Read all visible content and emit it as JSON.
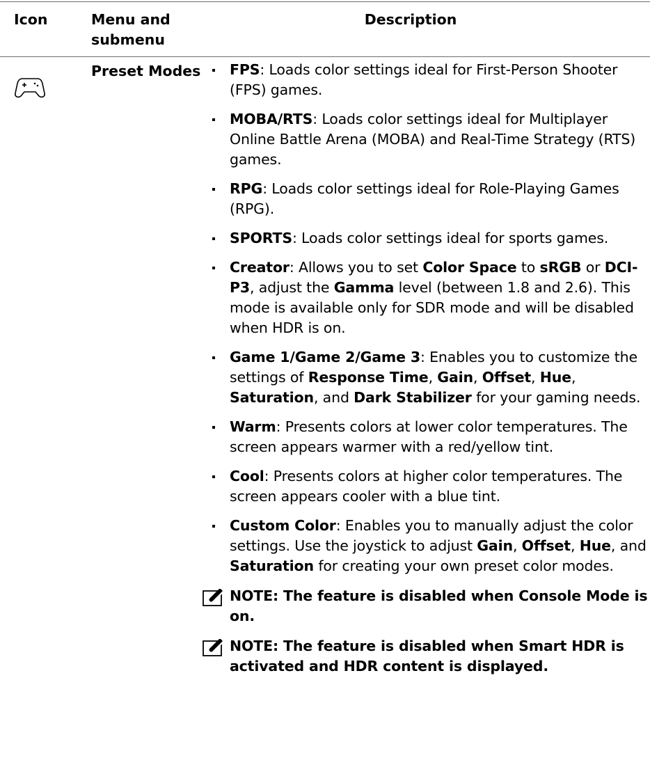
{
  "header": {
    "icon": "Icon",
    "menu": "Menu and submenu",
    "description": "Description"
  },
  "row": {
    "icon_name": "gamepad-icon",
    "menu": "Preset Modes",
    "items": [
      {
        "segments": [
          {
            "b": true,
            "t": "FPS"
          },
          {
            "t": ": Loads color settings ideal for First-Person Shooter (FPS) games."
          }
        ]
      },
      {
        "segments": [
          {
            "b": true,
            "t": "MOBA/RTS"
          },
          {
            "t": ": Loads color settings ideal for Multiplayer Online Battle Arena (MOBA) and Real-Time Strategy (RTS) games."
          }
        ]
      },
      {
        "segments": [
          {
            "b": true,
            "t": "RPG"
          },
          {
            "t": ": Loads color settings ideal for Role-Playing Games (RPG)."
          }
        ]
      },
      {
        "segments": [
          {
            "b": true,
            "t": "SPORTS"
          },
          {
            "t": ": Loads color settings ideal for sports games."
          }
        ]
      },
      {
        "segments": [
          {
            "b": true,
            "t": "Creator"
          },
          {
            "t": ": Allows you to set "
          },
          {
            "b": true,
            "t": "Color Space"
          },
          {
            "t": " to "
          },
          {
            "b": true,
            "t": "sRGB"
          },
          {
            "t": " or "
          },
          {
            "b": true,
            "t": "DCI-P3"
          },
          {
            "t": ", adjust the "
          },
          {
            "b": true,
            "t": "Gamma"
          },
          {
            "t": " level (between 1.8 and 2.6). This mode is available only for SDR mode and will be disabled when HDR is on."
          }
        ]
      },
      {
        "segments": [
          {
            "b": true,
            "t": "Game 1/Game 2/Game 3"
          },
          {
            "t": ": Enables you to customize the settings of "
          },
          {
            "b": true,
            "t": "Response Time"
          },
          {
            "t": ", "
          },
          {
            "b": true,
            "t": "Gain"
          },
          {
            "t": ", "
          },
          {
            "b": true,
            "t": "Offset"
          },
          {
            "t": ", "
          },
          {
            "b": true,
            "t": "Hue"
          },
          {
            "t": ", "
          },
          {
            "b": true,
            "t": "Saturation"
          },
          {
            "t": ", and "
          },
          {
            "b": true,
            "t": "Dark Stabilizer"
          },
          {
            "t": " for your gaming needs."
          }
        ]
      },
      {
        "segments": [
          {
            "b": true,
            "t": "Warm"
          },
          {
            "t": ": Presents colors at lower color temperatures. The screen appears warmer with a red/yellow tint."
          }
        ]
      },
      {
        "segments": [
          {
            "b": true,
            "t": "Cool"
          },
          {
            "t": ": Presents colors at higher color temperatures. The screen appears cooler with a blue tint."
          }
        ]
      },
      {
        "segments": [
          {
            "b": true,
            "t": "Custom Color"
          },
          {
            "t": ": Enables you to manually adjust the color settings. Use the joystick to adjust "
          },
          {
            "b": true,
            "t": "Gain"
          },
          {
            "t": ", "
          },
          {
            "b": true,
            "t": "Offset"
          },
          {
            "t": ", "
          },
          {
            "b": true,
            "t": "Hue"
          },
          {
            "t": ", and "
          },
          {
            "b": true,
            "t": "Saturation"
          },
          {
            "t": " for creating your own preset color modes."
          }
        ]
      }
    ],
    "notes": [
      "NOTE: The feature is disabled when Console Mode is on.",
      "NOTE: The feature is disabled when Smart HDR is activated and HDR content is displayed."
    ],
    "note_icon_name": "pencil-note-icon"
  }
}
